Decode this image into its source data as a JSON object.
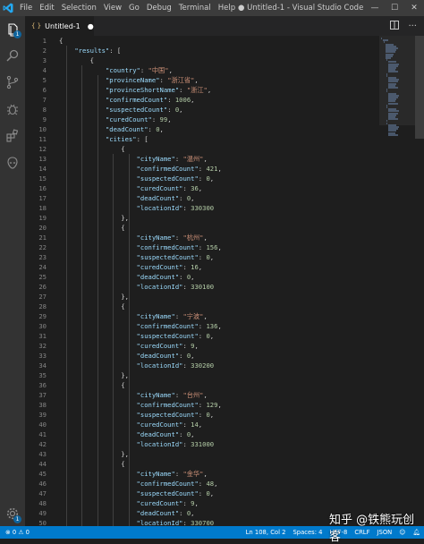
{
  "titlebar": {
    "menu": [
      "File",
      "Edit",
      "Selection",
      "View",
      "Go",
      "Debug",
      "Terminal",
      "Help"
    ],
    "window_title": "● Untitled-1 - Visual Studio Code",
    "controls": [
      "—",
      "☐",
      "✕"
    ]
  },
  "activity": {
    "explorer_badge": "1",
    "settings_badge": "1"
  },
  "tab": {
    "icon": "{ }",
    "label": "Untitled-1",
    "dirty_dot": "●"
  },
  "editor": {
    "lines": [
      {
        "n": "1",
        "t": [
          [
            "p",
            "{"
          ]
        ]
      },
      {
        "n": "2",
        "t": [
          [
            "p",
            "    "
          ],
          [
            "k",
            "\"results\""
          ],
          [
            "p",
            ": ["
          ]
        ]
      },
      {
        "n": "3",
        "t": [
          [
            "p",
            "        {"
          ]
        ]
      },
      {
        "n": "4",
        "t": [
          [
            "p",
            "            "
          ],
          [
            "k",
            "\"country\""
          ],
          [
            "p",
            ": "
          ],
          [
            "s",
            "\"中国\""
          ],
          [
            "p",
            ","
          ]
        ]
      },
      {
        "n": "5",
        "t": [
          [
            "p",
            "            "
          ],
          [
            "k",
            "\"provinceName\""
          ],
          [
            "p",
            ": "
          ],
          [
            "s",
            "\"浙江省\""
          ],
          [
            "p",
            ","
          ]
        ]
      },
      {
        "n": "6",
        "t": [
          [
            "p",
            "            "
          ],
          [
            "k",
            "\"provinceShortName\""
          ],
          [
            "p",
            ": "
          ],
          [
            "s",
            "\"浙江\""
          ],
          [
            "p",
            ","
          ]
        ]
      },
      {
        "n": "7",
        "t": [
          [
            "p",
            "            "
          ],
          [
            "k",
            "\"confirmedCount\""
          ],
          [
            "p",
            ": "
          ],
          [
            "n",
            "1006"
          ],
          [
            "p",
            ","
          ]
        ]
      },
      {
        "n": "8",
        "t": [
          [
            "p",
            "            "
          ],
          [
            "k",
            "\"suspectedCount\""
          ],
          [
            "p",
            ": "
          ],
          [
            "n",
            "0"
          ],
          [
            "p",
            ","
          ]
        ]
      },
      {
        "n": "9",
        "t": [
          [
            "p",
            "            "
          ],
          [
            "k",
            "\"curedCount\""
          ],
          [
            "p",
            ": "
          ],
          [
            "n",
            "99"
          ],
          [
            "p",
            ","
          ]
        ]
      },
      {
        "n": "10",
        "t": [
          [
            "p",
            "            "
          ],
          [
            "k",
            "\"deadCount\""
          ],
          [
            "p",
            ": "
          ],
          [
            "n",
            "0"
          ],
          [
            "p",
            ","
          ]
        ]
      },
      {
        "n": "11",
        "t": [
          [
            "p",
            "            "
          ],
          [
            "k",
            "\"cities\""
          ],
          [
            "p",
            ": ["
          ]
        ]
      },
      {
        "n": "12",
        "t": [
          [
            "p",
            "                {"
          ]
        ]
      },
      {
        "n": "13",
        "t": [
          [
            "p",
            "                    "
          ],
          [
            "k",
            "\"cityName\""
          ],
          [
            "p",
            ": "
          ],
          [
            "s",
            "\"温州\""
          ],
          [
            "p",
            ","
          ]
        ]
      },
      {
        "n": "14",
        "t": [
          [
            "p",
            "                    "
          ],
          [
            "k",
            "\"confirmedCount\""
          ],
          [
            "p",
            ": "
          ],
          [
            "n",
            "421"
          ],
          [
            "p",
            ","
          ]
        ]
      },
      {
        "n": "15",
        "t": [
          [
            "p",
            "                    "
          ],
          [
            "k",
            "\"suspectedCount\""
          ],
          [
            "p",
            ": "
          ],
          [
            "n",
            "0"
          ],
          [
            "p",
            ","
          ]
        ]
      },
      {
        "n": "16",
        "t": [
          [
            "p",
            "                    "
          ],
          [
            "k",
            "\"curedCount\""
          ],
          [
            "p",
            ": "
          ],
          [
            "n",
            "36"
          ],
          [
            "p",
            ","
          ]
        ]
      },
      {
        "n": "17",
        "t": [
          [
            "p",
            "                    "
          ],
          [
            "k",
            "\"deadCount\""
          ],
          [
            "p",
            ": "
          ],
          [
            "n",
            "0"
          ],
          [
            "p",
            ","
          ]
        ]
      },
      {
        "n": "18",
        "t": [
          [
            "p",
            "                    "
          ],
          [
            "k",
            "\"locationId\""
          ],
          [
            "p",
            ": "
          ],
          [
            "n",
            "330300"
          ]
        ]
      },
      {
        "n": "19",
        "t": [
          [
            "p",
            "                },"
          ]
        ]
      },
      {
        "n": "20",
        "t": [
          [
            "p",
            "                {"
          ]
        ]
      },
      {
        "n": "21",
        "t": [
          [
            "p",
            "                    "
          ],
          [
            "k",
            "\"cityName\""
          ],
          [
            "p",
            ": "
          ],
          [
            "s",
            "\"杭州\""
          ],
          [
            "p",
            ","
          ]
        ]
      },
      {
        "n": "22",
        "t": [
          [
            "p",
            "                    "
          ],
          [
            "k",
            "\"confirmedCount\""
          ],
          [
            "p",
            ": "
          ],
          [
            "n",
            "156"
          ],
          [
            "p",
            ","
          ]
        ]
      },
      {
        "n": "23",
        "t": [
          [
            "p",
            "                    "
          ],
          [
            "k",
            "\"suspectedCount\""
          ],
          [
            "p",
            ": "
          ],
          [
            "n",
            "0"
          ],
          [
            "p",
            ","
          ]
        ]
      },
      {
        "n": "24",
        "t": [
          [
            "p",
            "                    "
          ],
          [
            "k",
            "\"curedCount\""
          ],
          [
            "p",
            ": "
          ],
          [
            "n",
            "16"
          ],
          [
            "p",
            ","
          ]
        ]
      },
      {
        "n": "25",
        "t": [
          [
            "p",
            "                    "
          ],
          [
            "k",
            "\"deadCount\""
          ],
          [
            "p",
            ": "
          ],
          [
            "n",
            "0"
          ],
          [
            "p",
            ","
          ]
        ]
      },
      {
        "n": "26",
        "t": [
          [
            "p",
            "                    "
          ],
          [
            "k",
            "\"locationId\""
          ],
          [
            "p",
            ": "
          ],
          [
            "n",
            "330100"
          ]
        ]
      },
      {
        "n": "27",
        "t": [
          [
            "p",
            "                },"
          ]
        ]
      },
      {
        "n": "28",
        "t": [
          [
            "p",
            "                {"
          ]
        ]
      },
      {
        "n": "29",
        "t": [
          [
            "p",
            "                    "
          ],
          [
            "k",
            "\"cityName\""
          ],
          [
            "p",
            ": "
          ],
          [
            "s",
            "\"宁波\""
          ],
          [
            "p",
            ","
          ]
        ]
      },
      {
        "n": "30",
        "t": [
          [
            "p",
            "                    "
          ],
          [
            "k",
            "\"confirmedCount\""
          ],
          [
            "p",
            ": "
          ],
          [
            "n",
            "136"
          ],
          [
            "p",
            ","
          ]
        ]
      },
      {
        "n": "31",
        "t": [
          [
            "p",
            "                    "
          ],
          [
            "k",
            "\"suspectedCount\""
          ],
          [
            "p",
            ": "
          ],
          [
            "n",
            "0"
          ],
          [
            "p",
            ","
          ]
        ]
      },
      {
        "n": "32",
        "t": [
          [
            "p",
            "                    "
          ],
          [
            "k",
            "\"curedCount\""
          ],
          [
            "p",
            ": "
          ],
          [
            "n",
            "9"
          ],
          [
            "p",
            ","
          ]
        ]
      },
      {
        "n": "33",
        "t": [
          [
            "p",
            "                    "
          ],
          [
            "k",
            "\"deadCount\""
          ],
          [
            "p",
            ": "
          ],
          [
            "n",
            "0"
          ],
          [
            "p",
            ","
          ]
        ]
      },
      {
        "n": "34",
        "t": [
          [
            "p",
            "                    "
          ],
          [
            "k",
            "\"locationId\""
          ],
          [
            "p",
            ": "
          ],
          [
            "n",
            "330200"
          ]
        ]
      },
      {
        "n": "35",
        "t": [
          [
            "p",
            "                },"
          ]
        ]
      },
      {
        "n": "36",
        "t": [
          [
            "p",
            "                {"
          ]
        ]
      },
      {
        "n": "37",
        "t": [
          [
            "p",
            "                    "
          ],
          [
            "k",
            "\"cityName\""
          ],
          [
            "p",
            ": "
          ],
          [
            "s",
            "\"台州\""
          ],
          [
            "p",
            ","
          ]
        ]
      },
      {
        "n": "38",
        "t": [
          [
            "p",
            "                    "
          ],
          [
            "k",
            "\"confirmedCount\""
          ],
          [
            "p",
            ": "
          ],
          [
            "n",
            "129"
          ],
          [
            "p",
            ","
          ]
        ]
      },
      {
        "n": "39",
        "t": [
          [
            "p",
            "                    "
          ],
          [
            "k",
            "\"suspectedCount\""
          ],
          [
            "p",
            ": "
          ],
          [
            "n",
            "0"
          ],
          [
            "p",
            ","
          ]
        ]
      },
      {
        "n": "40",
        "t": [
          [
            "p",
            "                    "
          ],
          [
            "k",
            "\"curedCount\""
          ],
          [
            "p",
            ": "
          ],
          [
            "n",
            "14"
          ],
          [
            "p",
            ","
          ]
        ]
      },
      {
        "n": "41",
        "t": [
          [
            "p",
            "                    "
          ],
          [
            "k",
            "\"deadCount\""
          ],
          [
            "p",
            ": "
          ],
          [
            "n",
            "0"
          ],
          [
            "p",
            ","
          ]
        ]
      },
      {
        "n": "42",
        "t": [
          [
            "p",
            "                    "
          ],
          [
            "k",
            "\"locationId\""
          ],
          [
            "p",
            ": "
          ],
          [
            "n",
            "331000"
          ]
        ]
      },
      {
        "n": "43",
        "t": [
          [
            "p",
            "                },"
          ]
        ]
      },
      {
        "n": "44",
        "t": [
          [
            "p",
            "                {"
          ]
        ]
      },
      {
        "n": "45",
        "t": [
          [
            "p",
            "                    "
          ],
          [
            "k",
            "\"cityName\""
          ],
          [
            "p",
            ": "
          ],
          [
            "s",
            "\"金华\""
          ],
          [
            "p",
            ","
          ]
        ]
      },
      {
        "n": "46",
        "t": [
          [
            "p",
            "                    "
          ],
          [
            "k",
            "\"confirmedCount\""
          ],
          [
            "p",
            ": "
          ],
          [
            "n",
            "48"
          ],
          [
            "p",
            ","
          ]
        ]
      },
      {
        "n": "47",
        "t": [
          [
            "p",
            "                    "
          ],
          [
            "k",
            "\"suspectedCount\""
          ],
          [
            "p",
            ": "
          ],
          [
            "n",
            "0"
          ],
          [
            "p",
            ","
          ]
        ]
      },
      {
        "n": "48",
        "t": [
          [
            "p",
            "                    "
          ],
          [
            "k",
            "\"curedCount\""
          ],
          [
            "p",
            ": "
          ],
          [
            "n",
            "9"
          ],
          [
            "p",
            ","
          ]
        ]
      },
      {
        "n": "49",
        "t": [
          [
            "p",
            "                    "
          ],
          [
            "k",
            "\"deadCount\""
          ],
          [
            "p",
            ": "
          ],
          [
            "n",
            "0"
          ],
          [
            "p",
            ","
          ]
        ]
      },
      {
        "n": "50",
        "t": [
          [
            "p",
            "                    "
          ],
          [
            "k",
            "\"locationId\""
          ],
          [
            "p",
            ": "
          ],
          [
            "n",
            "330700"
          ]
        ]
      }
    ]
  },
  "statusbar": {
    "problems": "⊗ 0 ⚠ 0",
    "items": [
      "Ln 108, Col 2",
      "Spaces: 4",
      "UTF-8",
      "CRLF",
      "JSON"
    ]
  },
  "watermark": "知乎 @铁熊玩创客",
  "colors": {
    "accent": "#007acc",
    "key": "#9cdcfe",
    "string": "#ce9178",
    "number": "#b5cea8"
  }
}
